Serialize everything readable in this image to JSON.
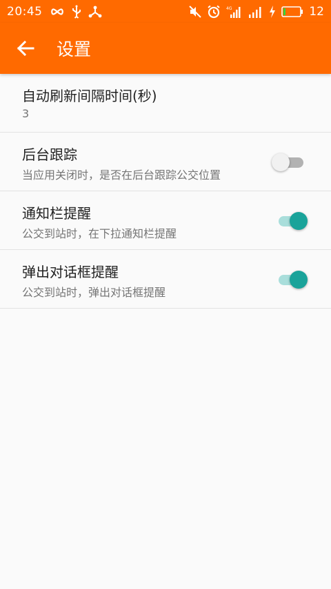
{
  "status_bar": {
    "time": "20:45",
    "battery_level": "12",
    "icons_left": [
      "infinity-icon",
      "usb-icon",
      "share-icon"
    ],
    "icons_right": [
      "mute-icon",
      "alarm-icon",
      "signal-4g-icon",
      "signal-icon",
      "charging-icon",
      "battery-icon"
    ]
  },
  "app_bar": {
    "title": "设置",
    "back_icon": "arrow-left-icon"
  },
  "settings": [
    {
      "title": "自动刷新间隔时间(秒)",
      "subtitle": "3",
      "has_switch": false
    },
    {
      "title": "后台跟踪",
      "subtitle": "当应用关闭时，是否在后台跟踪公交位置",
      "has_switch": true,
      "checked": false
    },
    {
      "title": "通知栏提醒",
      "subtitle": "公交到站时，在下拉通知栏提醒",
      "has_switch": true,
      "checked": true
    },
    {
      "title": "弹出对话框提醒",
      "subtitle": "公交到站时，弹出对话框提醒",
      "has_switch": true,
      "checked": true
    }
  ],
  "colors": {
    "primary": "#ff6a00",
    "switch_on": "#1aa39a",
    "switch_on_track": "#a9dedb",
    "switch_off_track": "#b2b2b2"
  }
}
